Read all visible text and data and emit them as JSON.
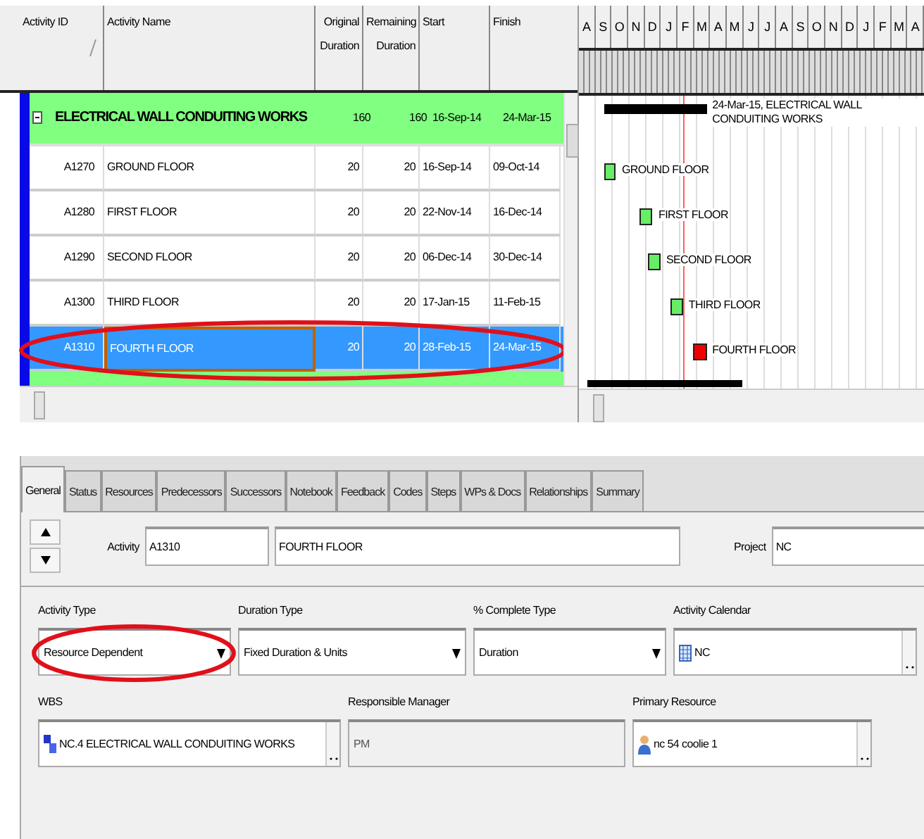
{
  "table": {
    "columns": [
      {
        "label": "Activity ID"
      },
      {
        "label": "Activity Name"
      },
      {
        "label": "Original Duration"
      },
      {
        "label": "Remaining Duration"
      },
      {
        "label": "Start"
      },
      {
        "label": "Finish"
      }
    ],
    "group": {
      "name": "ELECTRICAL WALL CONDUITING WORKS",
      "original_duration": "160",
      "remaining_duration": "160",
      "start": "16-Sep-14",
      "finish": "24-Mar-15",
      "expanded": true,
      "gantt_label": "24-Mar-15, ELECTRICAL WALL CONDUITING WORKS"
    },
    "activities": [
      {
        "id": "A1270",
        "name": "GROUND FLOOR",
        "original_duration": "20",
        "remaining_duration": "20",
        "start": "16-Sep-14",
        "finish": "09-Oct-14",
        "selected": false,
        "critical": false,
        "bar_label": "GROUND FLOOR"
      },
      {
        "id": "A1280",
        "name": "FIRST FLOOR",
        "original_duration": "20",
        "remaining_duration": "20",
        "start": "22-Nov-14",
        "finish": "16-Dec-14",
        "selected": false,
        "critical": false,
        "bar_label": "FIRST FLOOR"
      },
      {
        "id": "A1290",
        "name": "SECOND FLOOR",
        "original_duration": "20",
        "remaining_duration": "20",
        "start": "06-Dec-14",
        "finish": "30-Dec-14",
        "selected": false,
        "critical": false,
        "bar_label": "SECOND FLOOR"
      },
      {
        "id": "A1300",
        "name": "THIRD FLOOR",
        "original_duration": "20",
        "remaining_duration": "20",
        "start": "17-Jan-15",
        "finish": "11-Feb-15",
        "selected": false,
        "critical": false,
        "bar_label": "THIRD FLOOR"
      },
      {
        "id": "A1310",
        "name": "FOURTH FLOOR",
        "original_duration": "20",
        "remaining_duration": "20",
        "start": "28-Feb-15",
        "finish": "24-Mar-15",
        "selected": true,
        "critical": true,
        "bar_label": "FOURTH FLOOR"
      }
    ]
  },
  "timeline": {
    "months": [
      "A",
      "S",
      "O",
      "N",
      "D",
      "J",
      "F",
      "M",
      "A",
      "M",
      "J",
      "J",
      "A",
      "S",
      "O",
      "N",
      "D",
      "J",
      "F",
      "M",
      "A"
    ]
  },
  "tabs": [
    {
      "label": "General",
      "selected": true
    },
    {
      "label": "Status",
      "selected": false
    },
    {
      "label": "Resources",
      "selected": false
    },
    {
      "label": "Predecessors",
      "selected": false
    },
    {
      "label": "Successors",
      "selected": false
    },
    {
      "label": "Notebook",
      "selected": false
    },
    {
      "label": "Feedback",
      "selected": false
    },
    {
      "label": "Codes",
      "selected": false
    },
    {
      "label": "Steps",
      "selected": false
    },
    {
      "label": "WPs & Docs",
      "selected": false
    },
    {
      "label": "Relationships",
      "selected": false
    },
    {
      "label": "Summary",
      "selected": false
    }
  ],
  "activity": {
    "label": "Activity",
    "id": "A1310",
    "name": "FOURTH FLOOR",
    "project_label": "Project",
    "project": "NC"
  },
  "fields": [
    {
      "kind": "dropdown",
      "label": "Activity Type",
      "value": "Resource Dependent"
    },
    {
      "kind": "dropdown",
      "label": "Duration Type",
      "value": "Fixed Duration & Units"
    },
    {
      "kind": "dropdown",
      "label": "% Complete Type",
      "value": "Duration"
    },
    {
      "kind": "calendar",
      "label": "Activity Calendar",
      "value": "NC"
    },
    {
      "kind": "wbs",
      "label": "WBS",
      "value": "NC.4  ELECTRICAL WALL CONDUITING WORKS"
    },
    {
      "kind": "readonly",
      "label": "Responsible Manager",
      "value": "PM"
    },
    {
      "kind": "resource",
      "label": "Primary Resource",
      "value": "nc 54  coolie 1"
    }
  ]
}
